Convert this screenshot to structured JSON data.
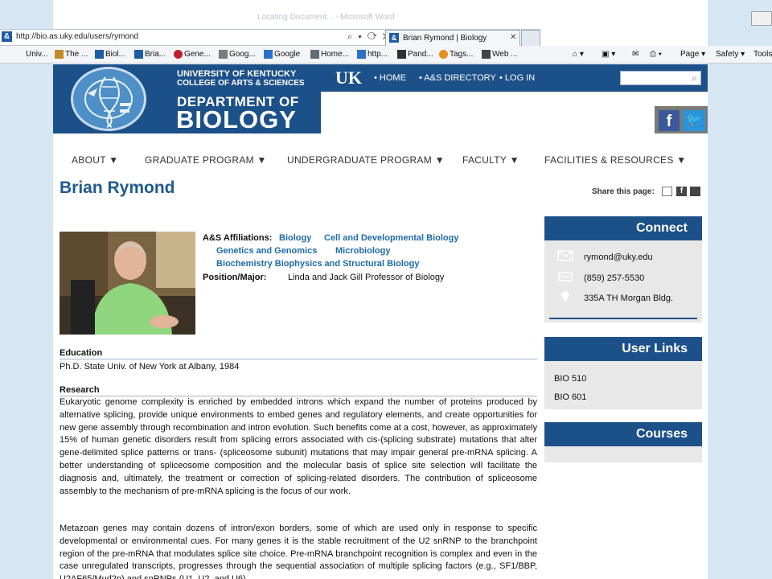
{
  "browser": {
    "top_faint": "Locating Document... - Microsoft Word",
    "url": "http://bio.as.uky.edu/users/rymond",
    "addr_controls": "⌕ ▾ ⟳ ✕",
    "tab_title": "Brian Rymond | Biology",
    "tab_close": "✕",
    "favorites": [
      "Univ...",
      "The ...",
      "Biol...",
      "Bria...",
      "Gene...",
      "Goog...",
      "Google",
      "Home...",
      "http...",
      "Pand...",
      "Tags...",
      "Web ..."
    ],
    "favorite_colors": [
      "#ffffff",
      "#c48a2a",
      "#1f5aa6",
      "#1f5aa6",
      "#c0202a",
      "#7b7b7b",
      "#2a6fc8",
      "#5f6c7a",
      "#2a6fc8",
      "#303030",
      "#e88c1a",
      "#444444"
    ],
    "toolbar": {
      "page": "Page ▾",
      "safety": "Safety ▾",
      "tools": "Tools"
    }
  },
  "site": {
    "uk_line": "UNIVERSITY OF KENTUCKY",
    "cas_line": "COLLEGE OF ARTS & SCIENCES",
    "dept_line": "DEPARTMENT OF",
    "bio_line": "BIOLOGY",
    "uk_logo": "UK",
    "top_nav": [
      "• HOME",
      "• A&S DIRECTORY",
      "• LOG IN"
    ],
    "search_placeholder": ""
  },
  "main_nav": [
    "ABOUT ▼",
    "GRADUATE PROGRAM ▼",
    "UNDERGRADUATE PROGRAM ▼",
    "FACULTY ▼",
    "FACILITIES & RESOURCES ▼"
  ],
  "profile": {
    "name": "Brian Rymond",
    "share_label": "Share this page:",
    "affiliations_label": "A&S Affiliations:",
    "affiliations": [
      "Biology",
      "Cell and Developmental Biology",
      "Genetics and Genomics",
      "Microbiology",
      "Biochemistry Biophysics and Structural Biology"
    ],
    "position_label": "Position/Major:",
    "position_value": "Linda and Jack Gill Professor of Biology",
    "education_head": "Education",
    "education_text": "Ph.D. State Univ. of New York at Albany, 1984",
    "research_head": "Research",
    "research_p1": "Eukaryotic genome complexity is enriched by embedded introns which expand the number of proteins produced by alternative splicing, provide unique environments to embed genes and regulatory elements, and create opportunities for new gene assembly through recombination and intron evolution. Such benefits come at a cost, however, as approximately 15% of human genetic disorders result from splicing errors associated with cis-(splicing substrate) mutations that alter gene-delimited splice patterns or trans- (spliceosome subunit) mutations that may impair general pre-mRNA splicing. A better understanding of spliceosome composition and the molecular basis of splice site selection will facilitate the diagnosis and, ultimately, the treatment or correction of splicing-related disorders. The contribution of spliceosome assembly to the mechanism of pre-mRNA splicing is the focus of our work.",
    "research_p2": "Metazoan genes may contain dozens of intron/exon borders, some of which are used only in response to specific developmental or environmental cues. For many genes it is the stable recruitment of the U2 snRNP to the branchpoint region of the pre-mRNA that modulates splice site choice. Pre-mRNA branchpoint recognition is complex and even in the case unregulated transcripts, progresses through the sequential association of multiple splicing factors (e.g., SF1/BBP, U2AF65/Mud2p) and snRNPs (U1, U2, and U6)."
  },
  "sidebar": {
    "connect_head": "Connect",
    "email": "rymond@uky.edu",
    "phone": "(859) 257-5530",
    "office": "335A TH Morgan Bldg.",
    "links_head": "User Links",
    "links": [
      "BIO 510",
      "BIO 601"
    ],
    "courses_head": "Courses"
  }
}
